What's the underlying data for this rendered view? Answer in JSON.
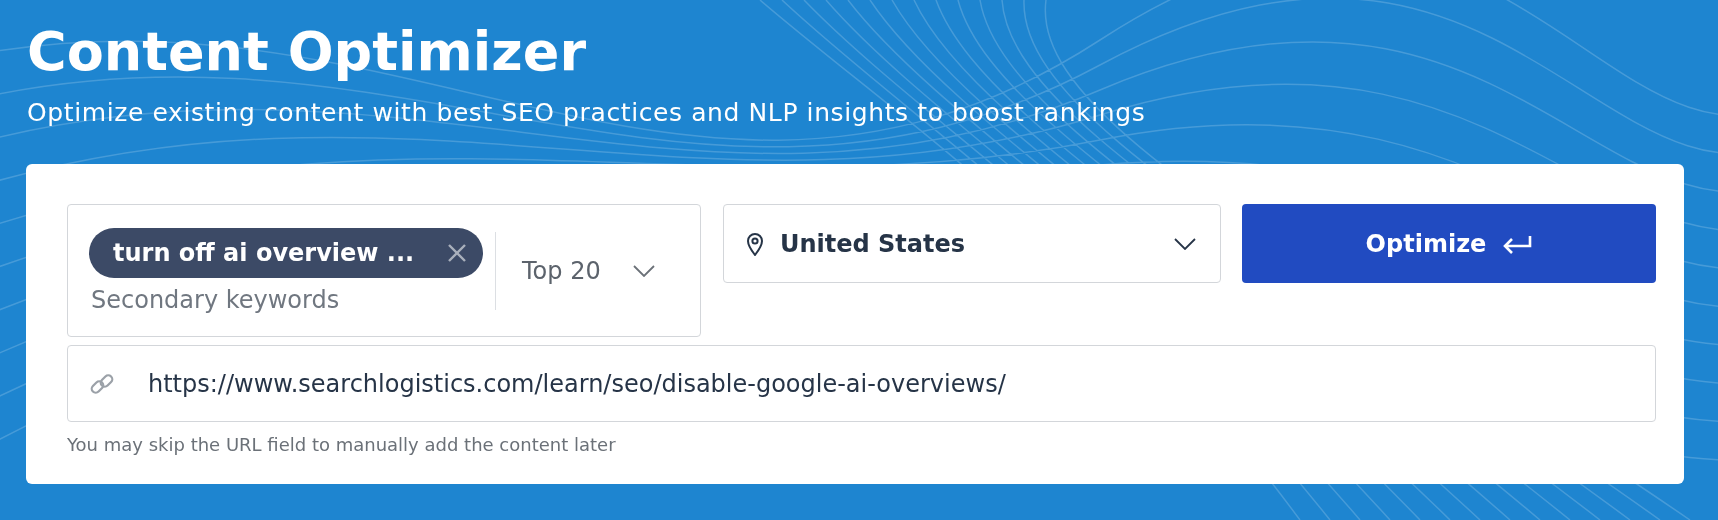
{
  "header": {
    "title": "Content Optimizer",
    "subtitle": "Optimize existing content with best SEO practices and NLP insights to boost rankings"
  },
  "form": {
    "keyword_chip": {
      "label": "turn off ai overview ..."
    },
    "secondary_keywords": {
      "placeholder": "Secondary keywords"
    },
    "results_dropdown": {
      "value": "Top 20"
    },
    "location_dropdown": {
      "value": "United States"
    },
    "optimize_button": {
      "label": "Optimize"
    },
    "url_field": {
      "value": "https://www.searchlogistics.com/learn/seo/disable-google-ai-overviews/"
    },
    "hint": "You may skip the URL field to manually add the content later"
  }
}
